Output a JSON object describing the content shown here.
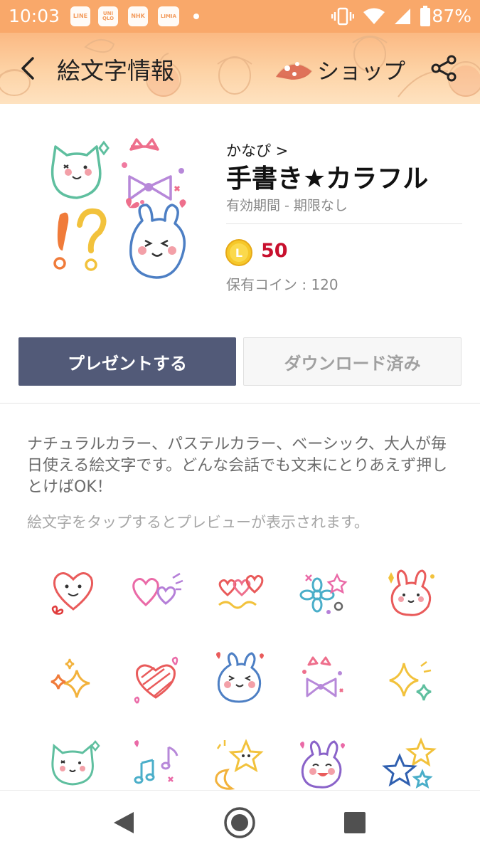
{
  "status_bar": {
    "time": "10:03",
    "notifications": [
      "LINE",
      "UNI QLO",
      "NHK",
      "LIMIA"
    ],
    "battery": "87%"
  },
  "header": {
    "title": "絵文字情報",
    "shop_label": "ショップ"
  },
  "product": {
    "author": "かなぴ >",
    "name": "手書き★カラフル",
    "validity": "有効期間 - 期限なし",
    "coin_symbol": "L",
    "price": "50",
    "owned_coins": "保有コイン : 120"
  },
  "buttons": {
    "present_label": "プレゼントする",
    "downloaded_label": "ダウンロード済み"
  },
  "description": {
    "text": "ナチュラルカラー、パステルカラー、ベーシック、大人が毎日使える絵文字です。どんな会話でも文末にとりあえず押しとけばOK！",
    "hint": "絵文字をタップするとプレビューが表示されます。"
  },
  "emoji_grid": [
    "heart-face",
    "hearts",
    "hearts-swirl",
    "flowers",
    "rabbit-pink",
    "sparkles-orange",
    "striped-heart",
    "rabbit-blue",
    "ribbon",
    "sparkles-yellow",
    "cat-green",
    "music-notes",
    "moon-star",
    "rabbit-purple",
    "stars-blue"
  ],
  "colors": {
    "accent_header": "#f9a86a",
    "present_button": "#525a78",
    "price": "#c8102e",
    "coin": "#f6c82a"
  }
}
